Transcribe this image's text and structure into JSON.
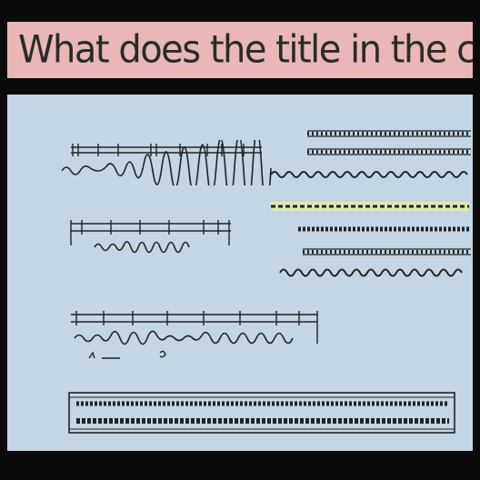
{
  "header": {
    "question": "What does the title in the chapter"
  },
  "colors": {
    "header_bg": "#e9b7b7",
    "panel_bg": "#c4d6e3",
    "ink": "#222222",
    "highlight": "#e6f09a"
  },
  "icons": {
    "staff_lines": "staff-lines-icon",
    "scribble_text": "scribble-text-icon"
  }
}
